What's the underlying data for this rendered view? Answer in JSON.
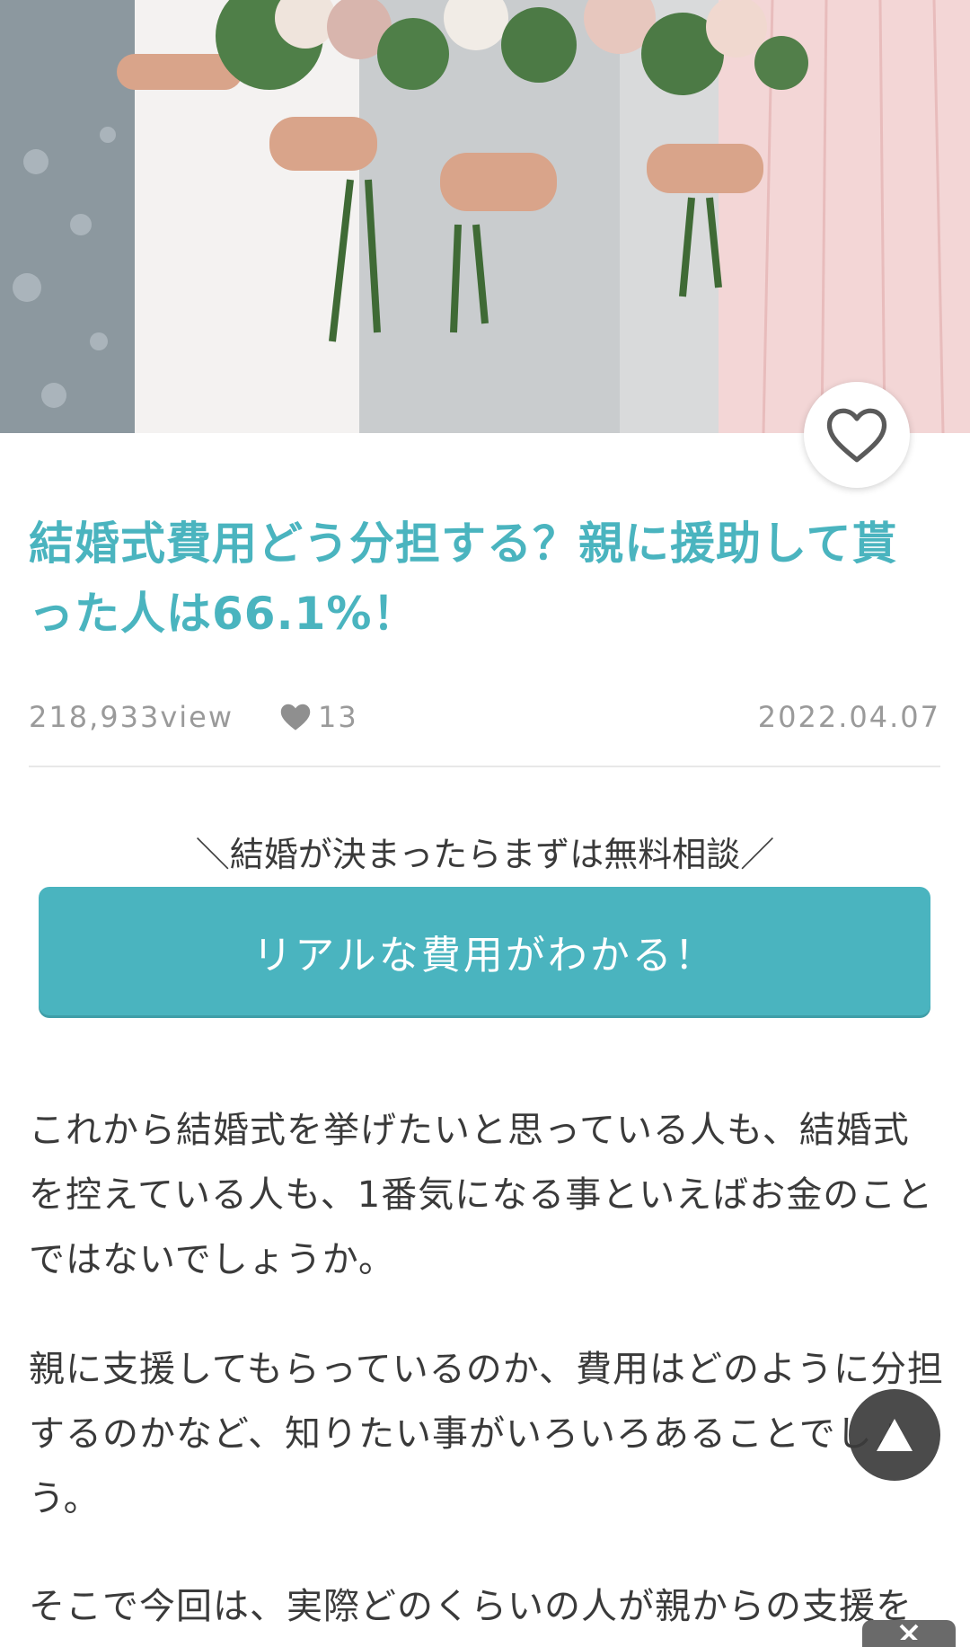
{
  "article": {
    "title": "結婚式費用どう分担する？親に援助して貰った人は66.1%！",
    "views": "218,933view",
    "likes": "13",
    "date": "2022.04.07"
  },
  "cta": {
    "caption": "＼結婚が決まったらまずは無料相談／",
    "button_label": "リアルな費用がわかる！"
  },
  "body": {
    "paragraphs": [
      "これから結婚式を挙げたいと思っている人も、結婚式を控えている人も、1番気になる事といえばお金のことではないでしょうか。",
      "親に支援してもらっているのか、費用はどのように分担するのかなど、知りたい事がいろいろあることでしょう。",
      "そこで今回は、実際どのくらいの人が親からの支援を"
    ]
  },
  "icons": {
    "favorite": "heart-outline-icon",
    "likes": "heart-filled-icon",
    "scroll_top": "triangle-up-icon",
    "close": "close-icon"
  },
  "colors": {
    "accent": "#4ab4bf",
    "text": "#3a3a3a",
    "meta": "#9a9a9a"
  }
}
